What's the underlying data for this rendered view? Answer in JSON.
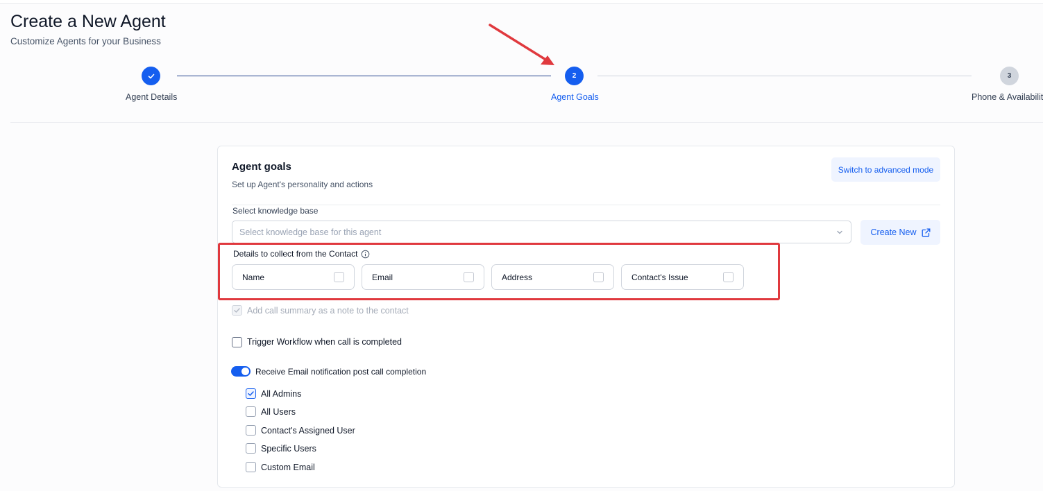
{
  "page": {
    "title": "Create a New Agent",
    "subtitle": "Customize Agents for your Business"
  },
  "stepper": {
    "steps": [
      {
        "number": "1",
        "label": "Agent Details",
        "state": "completed"
      },
      {
        "number": "2",
        "label": "Agent Goals",
        "state": "active"
      },
      {
        "number": "3",
        "label": "Phone & Availabilit",
        "state": "upcoming"
      }
    ]
  },
  "card": {
    "title": "Agent goals",
    "subtitle": "Set up Agent's personality and actions",
    "advanced_mode_label": "Switch to advanced mode",
    "knowledge_base": {
      "label": "Select knowledge base",
      "placeholder": "Select knowledge base for this agent",
      "create_new_label": "Create New"
    },
    "details": {
      "label": "Details to collect from the Contact",
      "options": [
        {
          "label": "Name",
          "checked": false
        },
        {
          "label": "Email",
          "checked": false
        },
        {
          "label": "Address",
          "checked": false
        },
        {
          "label": "Contact's Issue",
          "checked": false
        }
      ]
    },
    "call_summary": {
      "label": "Add call summary as a note to the contact",
      "checked": true,
      "disabled": true
    },
    "trigger_workflow": {
      "label": "Trigger Workflow when call is completed",
      "checked": false
    },
    "email_notification": {
      "label": "Receive Email notification post call completion",
      "enabled": true,
      "recipients": [
        {
          "label": "All Admins",
          "checked": true
        },
        {
          "label": "All Users",
          "checked": false
        },
        {
          "label": "Contact's Assigned User",
          "checked": false
        },
        {
          "label": "Specific Users",
          "checked": false
        },
        {
          "label": "Custom Email",
          "checked": false
        }
      ]
    }
  },
  "colors": {
    "primary": "#155eef",
    "annotation_red": "#e0393e"
  },
  "icons": {
    "step_complete": "check-icon",
    "info": "info-circle-icon",
    "dropdown": "chevron-down-icon",
    "external": "external-link-icon"
  }
}
